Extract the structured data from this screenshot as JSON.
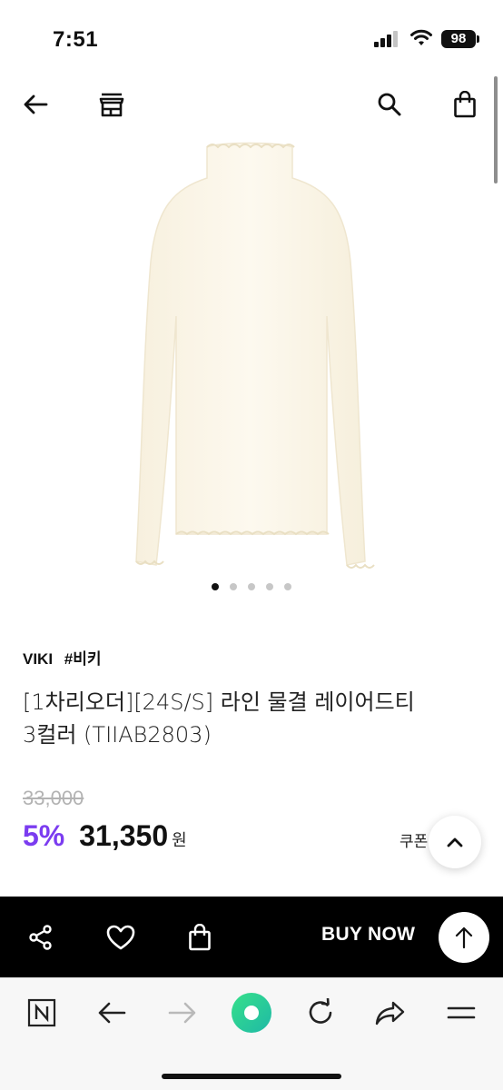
{
  "status_bar": {
    "time": "7:51",
    "battery": "98"
  },
  "top_nav": {
    "icons": [
      "back-arrow-icon",
      "store-icon",
      "search-icon",
      "shopping-bag-icon"
    ]
  },
  "carousel": {
    "total_pages": 5,
    "active_index": 0
  },
  "product": {
    "brand": "VIKI",
    "brand_tag": "#비키",
    "title_line1": "[1차리오더][24S/S] 라인 물결 레이어드티",
    "title_line2": "3컬러 (TIIAB2803)",
    "original_price": "33,000",
    "discount": "5%",
    "price": "31,350",
    "currency": "원",
    "coupon_label": "쿠폰"
  },
  "action_bar": {
    "buy_now_label": "BUY NOW",
    "icons": [
      "share-icon",
      "heart-icon",
      "cart-icon",
      "arrow-up-icon"
    ]
  },
  "browser_bar": {
    "icons": [
      "naver-n-icon",
      "back-icon",
      "forward-icon",
      "green-home-icon",
      "reload-icon",
      "share-arrow-icon",
      "menu-icon"
    ]
  },
  "colors": {
    "discount": "#7b3cf0",
    "action_bar_bg": "#000000",
    "green_home": "#2ed67a",
    "product_cream": "#fbf6ea"
  }
}
